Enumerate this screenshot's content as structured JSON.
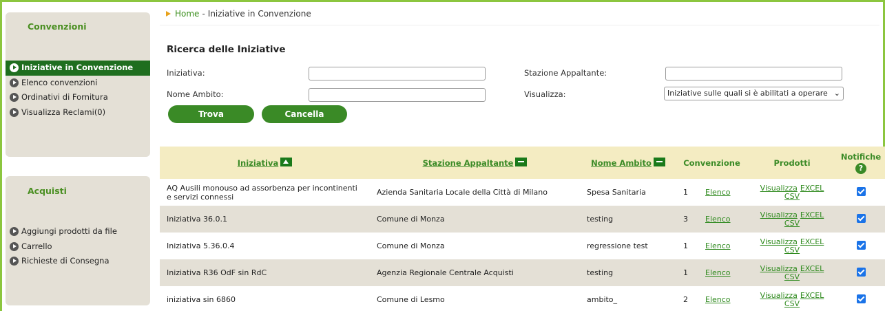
{
  "sidebar": {
    "convenzioni": {
      "title": "Convenzioni",
      "items": [
        {
          "label": "Iniziative in Convenzione",
          "active": true
        },
        {
          "label": "Elenco convenzioni",
          "active": false
        },
        {
          "label": "Ordinativi di Fornitura",
          "active": false
        },
        {
          "label": "Visualizza Reclami(0)",
          "active": false
        }
      ]
    },
    "acquisti": {
      "title": "Acquisti",
      "items": [
        {
          "label": "Aggiungi prodotti da file"
        },
        {
          "label": "Carrello"
        },
        {
          "label": "Richieste di Consegna"
        }
      ]
    }
  },
  "breadcrumb": {
    "home": "Home",
    "separator": "-",
    "current": "Iniziative in Convenzione"
  },
  "search": {
    "title": "Ricerca delle Iniziative",
    "iniziativa_label": "Iniziativa:",
    "iniziativa_value": "",
    "stazione_label": "Stazione Appaltante:",
    "stazione_value": "",
    "nome_ambito_label": "Nome Ambito:",
    "nome_ambito_value": "",
    "visualizza_label": "Visualizza:",
    "visualizza_selected": "Iniziative sulle quali si è abilitati a operare",
    "trova_label": "Trova",
    "cancella_label": "Cancella"
  },
  "table": {
    "headers": {
      "iniziativa": "Iniziativa",
      "stazione": "Stazione Appaltante",
      "ambito": "Nome Ambito",
      "convenzione": "Convenzione",
      "prodotti": "Prodotti",
      "notifiche": "Notifiche",
      "help": "?"
    },
    "link_labels": {
      "elenco": "Elenco",
      "visualizza": "Visualizza",
      "excel": "EXCEL",
      "csv": "CSV"
    },
    "rows": [
      {
        "iniziativa": "AQ Ausili monouso ad assorbenza per incontinenti e servizi connessi",
        "stazione": "Azienda Sanitaria Locale della Città di Milano",
        "ambito": "Spesa Sanitaria",
        "convenzione": "1",
        "notifica": true
      },
      {
        "iniziativa": "Iniziativa 36.0.1",
        "stazione": "Comune di Monza",
        "ambito": "testing",
        "convenzione": "3",
        "notifica": true
      },
      {
        "iniziativa": "Iniziativa 5.36.0.4",
        "stazione": "Comune di Monza",
        "ambito": "regressione test",
        "convenzione": "1",
        "notifica": true
      },
      {
        "iniziativa": "Iniziativa R36 OdF sin RdC",
        "stazione": "Agenzia Regionale Centrale Acquisti",
        "ambito": "testing",
        "convenzione": "1",
        "notifica": true
      },
      {
        "iniziativa": "iniziativa sin 6860",
        "stazione": "Comune di Lesmo",
        "ambito": "ambito_",
        "convenzione": "2",
        "notifica": true
      }
    ]
  },
  "colors": {
    "brand_green": "#3a8a26",
    "active_green": "#1f6e1f",
    "frame_green": "#8cc63f",
    "header_bg": "#f4ecc2",
    "panel_bg": "#e4e0d6"
  }
}
